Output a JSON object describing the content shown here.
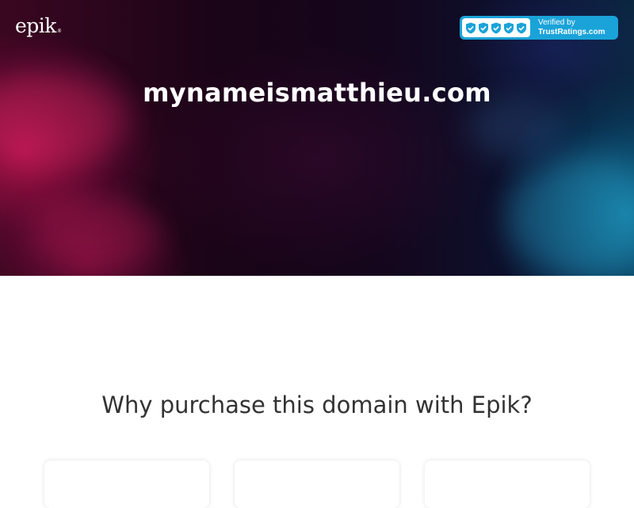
{
  "header": {
    "logo_text": "epik",
    "logo_mark": "®"
  },
  "trust_badge": {
    "line1": "Verified by",
    "line2": "TrustRatings.com",
    "shield_count": 5,
    "color": "#1aa3d9"
  },
  "hero": {
    "domain": "mynameismatthieu.com"
  },
  "why": {
    "heading": "Why purchase this domain with Epik?",
    "cards": [
      {
        "icon": "card"
      },
      {
        "icon": "card"
      },
      {
        "icon": "card"
      }
    ]
  }
}
